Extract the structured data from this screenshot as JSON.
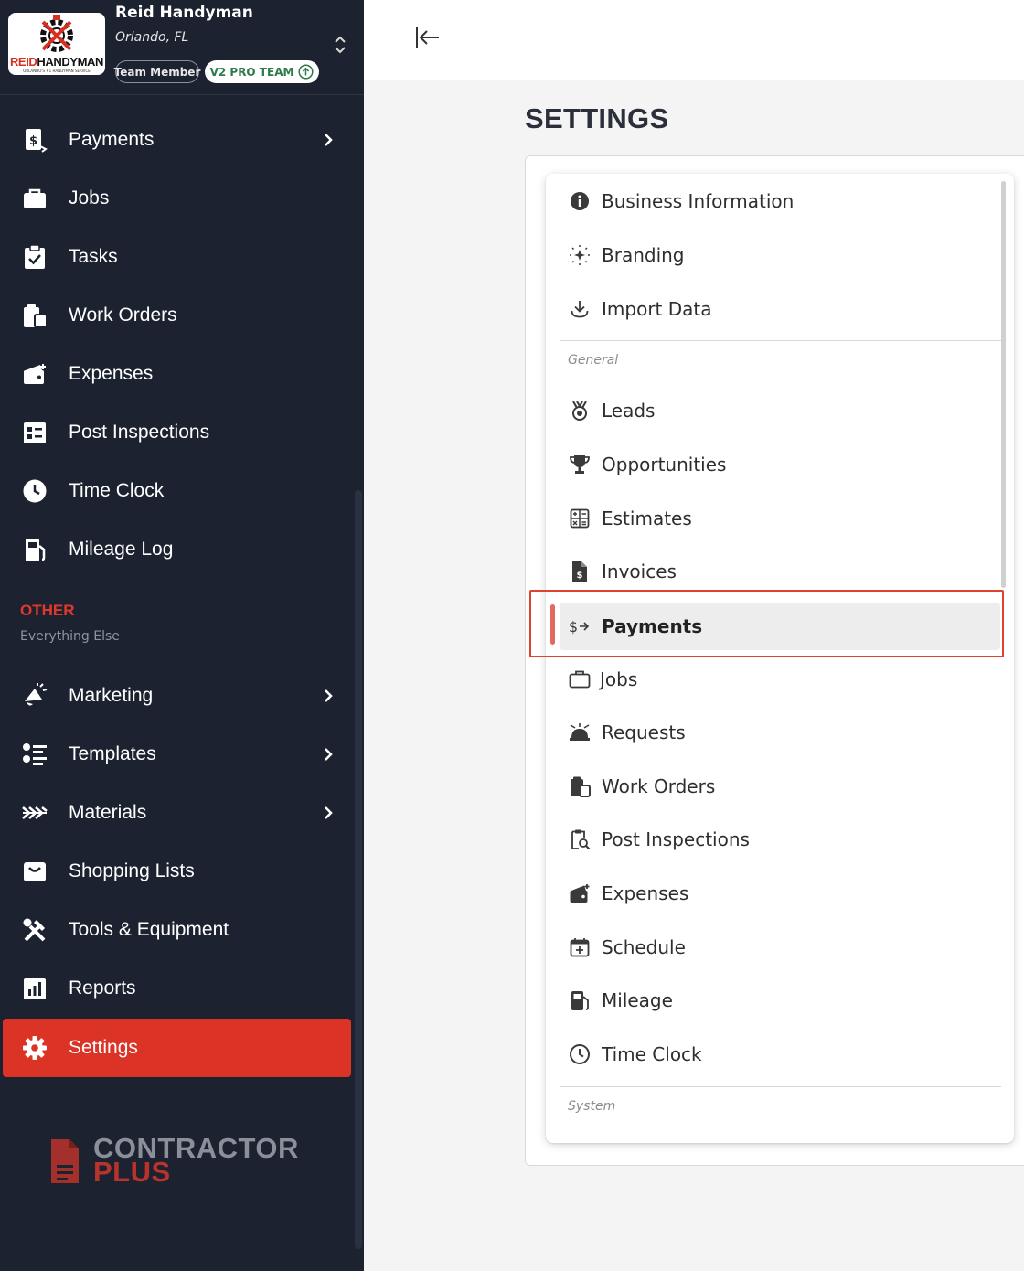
{
  "account": {
    "logo_word_1": "REID",
    "logo_word_2": "HANDYMAN",
    "logo_tagline": "ORLANDO'S #1 HANDYMAN SERVICE",
    "business_name": "Reid Handyman",
    "location": "Orlando, FL",
    "role_badge": "Team Member",
    "plan_badge": "V2 PRO TEAM"
  },
  "sidebar": {
    "items": [
      {
        "label": "Payments",
        "icon": "payments-icon",
        "has_submenu": true
      },
      {
        "label": "Jobs",
        "icon": "briefcase-icon",
        "has_submenu": false
      },
      {
        "label": "Tasks",
        "icon": "clipboard-check-icon",
        "has_submenu": false
      },
      {
        "label": "Work Orders",
        "icon": "work-orders-icon",
        "has_submenu": false
      },
      {
        "label": "Expenses",
        "icon": "wallet-icon",
        "has_submenu": false
      },
      {
        "label": "Post Inspections",
        "icon": "inspection-list-icon",
        "has_submenu": false
      },
      {
        "label": "Time Clock",
        "icon": "clock-icon",
        "has_submenu": false
      },
      {
        "label": "Mileage Log",
        "icon": "fuel-pump-icon",
        "has_submenu": false
      }
    ],
    "other_section": {
      "title": "OTHER",
      "subtitle": "Everything Else",
      "items": [
        {
          "label": "Marketing",
          "icon": "megaphone-icon",
          "has_submenu": true
        },
        {
          "label": "Templates",
          "icon": "templates-icon",
          "has_submenu": true
        },
        {
          "label": "Materials",
          "icon": "materials-icon",
          "has_submenu": true
        },
        {
          "label": "Shopping Lists",
          "icon": "shopping-bag-icon",
          "has_submenu": false
        },
        {
          "label": "Tools & Equipment",
          "icon": "tools-icon",
          "has_submenu": false
        },
        {
          "label": "Reports",
          "icon": "chart-icon",
          "has_submenu": false
        },
        {
          "label": "Settings",
          "icon": "gear-icon",
          "has_submenu": false,
          "active": true
        }
      ]
    },
    "brand_line_1": "CONTRACTOR",
    "brand_line_2": "PLUS"
  },
  "main": {
    "title": "SETTINGS",
    "menu": {
      "top_items": [
        {
          "label": "Business Information",
          "icon": "info-icon"
        },
        {
          "label": "Branding",
          "icon": "sparkle-icon"
        },
        {
          "label": "Import Data",
          "icon": "download-icon"
        }
      ],
      "general_label": "General",
      "general_items": [
        {
          "label": "Leads",
          "icon": "medal-icon"
        },
        {
          "label": "Opportunities",
          "icon": "trophy-icon"
        },
        {
          "label": "Estimates",
          "icon": "calculator-icon"
        },
        {
          "label": "Invoices",
          "icon": "invoice-icon"
        },
        {
          "label": "Payments",
          "icon": "dollar-arrow-icon",
          "selected": true
        },
        {
          "label": "Jobs",
          "icon": "briefcase-outline-icon"
        },
        {
          "label": "Requests",
          "icon": "service-bell-icon"
        },
        {
          "label": "Work Orders",
          "icon": "work-orders-icon"
        },
        {
          "label": "Post Inspections",
          "icon": "inspection-search-icon"
        },
        {
          "label": "Expenses",
          "icon": "wallet-icon"
        },
        {
          "label": "Schedule",
          "icon": "calendar-plus-icon"
        },
        {
          "label": "Mileage",
          "icon": "fuel-pump-icon"
        },
        {
          "label": "Time Clock",
          "icon": "clock-outline-icon"
        }
      ],
      "system_label": "System"
    }
  },
  "colors": {
    "sidebar_bg": "#1c2230",
    "accent_red": "#dc3327",
    "highlight_border": "#e04232",
    "plan_green": "#2e7a4b"
  }
}
